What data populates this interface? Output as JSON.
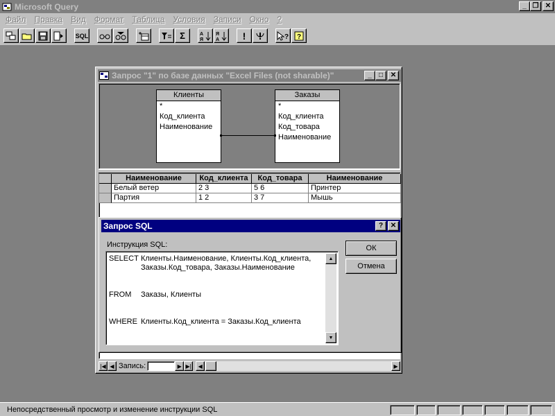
{
  "app": {
    "title": "Microsoft Query"
  },
  "menu": [
    "Файл",
    "Правка",
    "Вид",
    "Формат",
    "Таблица",
    "Условия",
    "Записи",
    "Окно",
    "?"
  ],
  "toolbar": {
    "sql_label": "SQL",
    "exclamation": "!",
    "sigma": "Σ",
    "filter_eq": "="
  },
  "query_window": {
    "title": "Запрос \"1\" по базе данных \"Excel Files (not sharable)\"",
    "tables": [
      {
        "name": "Клиенты",
        "fields": [
          "*",
          "Код_клиента",
          "Наименование"
        ]
      },
      {
        "name": "Заказы",
        "fields": [
          "*",
          "Код_клиента",
          "Код_товара",
          "Наименование"
        ]
      }
    ],
    "grid": {
      "columns": [
        "Наименование",
        "Код_клиента",
        "Код_товара",
        "Наименование"
      ],
      "rows": [
        [
          "Белый ветер",
          "2 3",
          "5 6",
          "Принтер"
        ],
        [
          "Партия",
          "1 2",
          "3 7",
          "Мышь"
        ]
      ]
    },
    "record_label": "Запись:"
  },
  "sql_dialog": {
    "title": "Запрос SQL",
    "label": "Инструкция SQL:",
    "lines": [
      {
        "kw": "SELECT",
        "text": "Клиенты.Наименование, Клиенты.Код_клиента, Заказы.Код_товара, Заказы.Наименование"
      },
      {
        "kw": "FROM",
        "text": "Заказы,  Клиенты"
      },
      {
        "kw": "WHERE",
        "text": "Клиенты.Код_клиента = Заказы.Код_клиента"
      }
    ],
    "ok": "ОК",
    "cancel": "Отмена"
  },
  "status": {
    "text": "Непосредственный просмотр и изменение инструкции SQL"
  }
}
